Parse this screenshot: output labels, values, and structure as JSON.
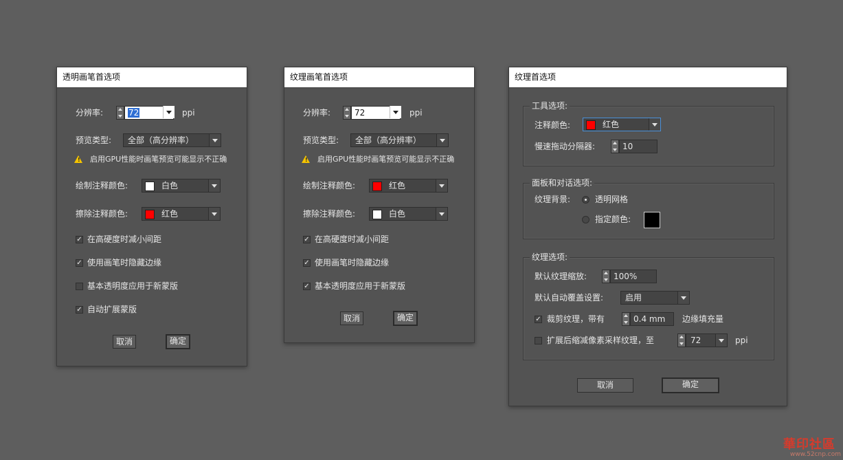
{
  "d1": {
    "title": "透明画笔首选项",
    "res_label": "分辨率:",
    "res_value": "72",
    "res_unit": "ppi",
    "preview_label": "预览类型:",
    "preview_value": "全部（高分辨率）",
    "warning": "启用GPU性能时画笔预览可能显示不正确",
    "draw_color_label": "绘制注释颜色:",
    "draw_color_value": "白色",
    "draw_color_hex": "#ffffff",
    "erase_color_label": "擦除注释颜色:",
    "erase_color_value": "红色",
    "erase_color_hex": "#ff0000",
    "cb1": "在高硬度时减小间距",
    "cb2": "使用画笔时隐藏边缘",
    "cb3": "基本透明度应用于新蒙版",
    "cb4": "自动扩展蒙版",
    "cb1_checked": true,
    "cb2_checked": true,
    "cb3_checked": false,
    "cb4_checked": true,
    "cancel": "取消",
    "ok": "确定"
  },
  "d2": {
    "title": "纹理画笔首选项",
    "res_label": "分辨率:",
    "res_value": "72",
    "res_unit": "ppi",
    "preview_label": "预览类型:",
    "preview_value": "全部（高分辨率）",
    "warning": "启用GPU性能时画笔预览可能显示不正确",
    "draw_color_label": "绘制注释颜色:",
    "draw_color_value": "红色",
    "draw_color_hex": "#ff0000",
    "erase_color_label": "擦除注释颜色:",
    "erase_color_value": "白色",
    "erase_color_hex": "#ffffff",
    "cb1": "在高硬度时减小间距",
    "cb2": "使用画笔时隐藏边缘",
    "cb3": "基本透明度应用于新蒙版",
    "cb1_checked": true,
    "cb2_checked": true,
    "cb3_checked": true,
    "cancel": "取消",
    "ok": "确定"
  },
  "d3": {
    "title": "纹理首选项",
    "tools": {
      "legend": "工具选项:",
      "annot_label": "注释颜色:",
      "annot_value": "红色",
      "annot_hex": "#ff0000",
      "slow_label": "慢速拖动分隔器:",
      "slow_value": "10"
    },
    "panel": {
      "legend": "面板和对话选项:",
      "bg_label": "纹理背景:",
      "opt_grid": "透明网格",
      "opt_color": "指定颜色:",
      "color_hex": "#000000"
    },
    "texture": {
      "legend": "纹理选项:",
      "scale_label": "默认纹理缩放:",
      "scale_value": "100%",
      "overlay_label": "默认自动覆盖设置:",
      "overlay_value": "启用",
      "crop_label": "裁剪纹理，带有",
      "crop_value": "0.4 mm",
      "crop_suffix": "边缘填充量",
      "crop_checked": true,
      "expand_label": "扩展后缩减像素采样纹理，至",
      "expand_value": "72",
      "expand_unit": "ppi",
      "expand_checked": false
    },
    "cancel": "取消",
    "ok": "确定"
  },
  "watermark": {
    "text": "華印社區",
    "url": "www.52cnp.com"
  }
}
